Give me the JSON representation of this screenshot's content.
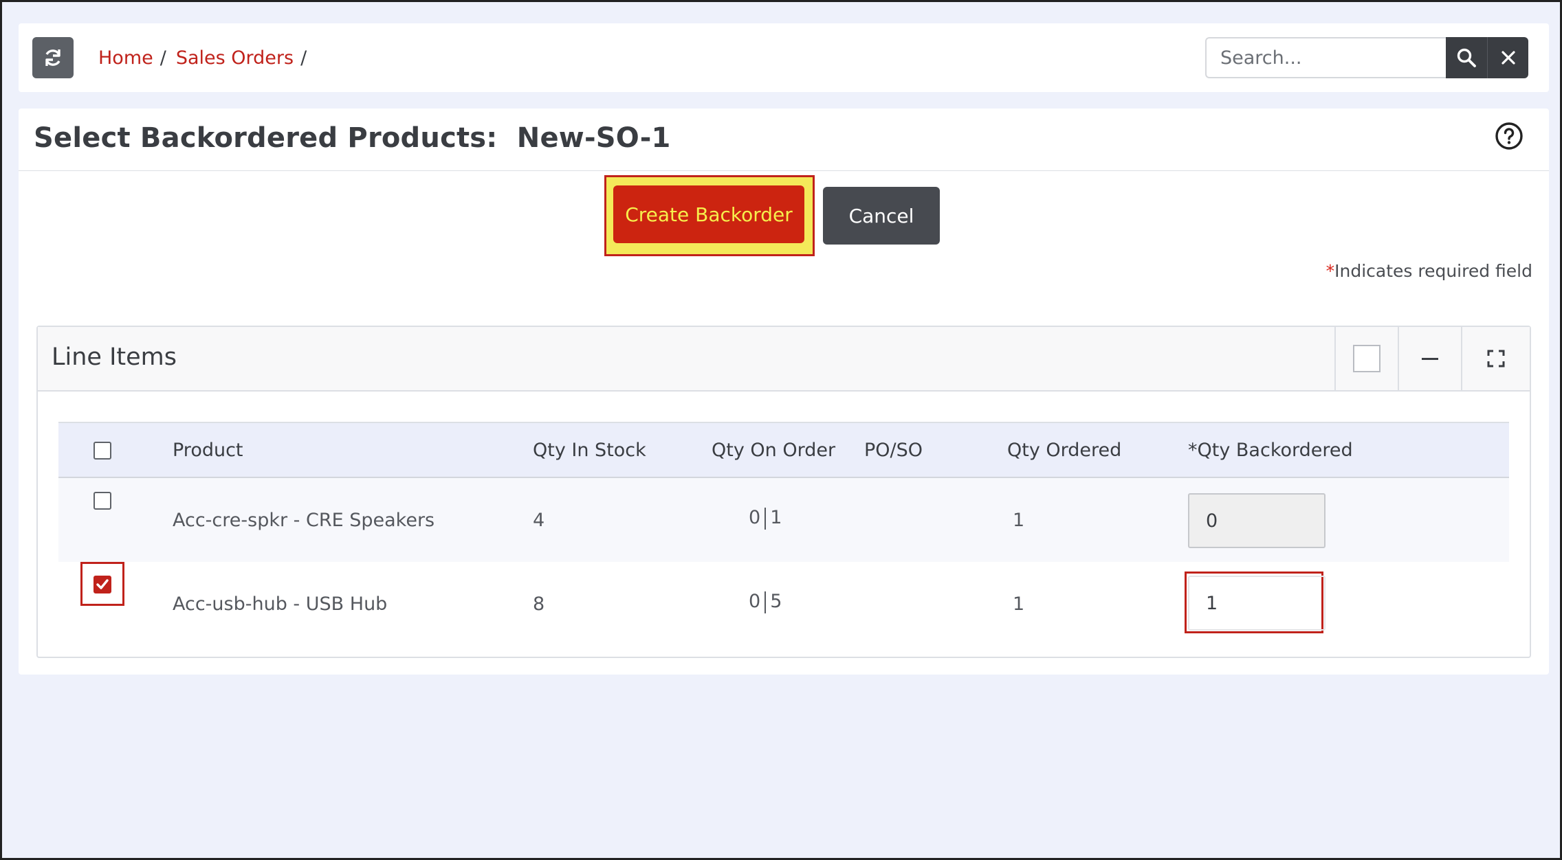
{
  "header": {
    "breadcrumb": [
      "Home",
      "Sales Orders"
    ],
    "search_placeholder": "Search...",
    "icons": [
      "refresh-icon",
      "search-icon",
      "close-icon"
    ]
  },
  "page": {
    "title_prefix": "Select Backordered Products:",
    "title_order": "New-SO-1",
    "create_label": "Create Backorder",
    "cancel_label": "Cancel",
    "required_star": "*",
    "required_text": "Indicates required field"
  },
  "panel": {
    "title": "Line Items",
    "tool_icons": [
      "select-icon",
      "minimize-icon",
      "expand-icon"
    ]
  },
  "table": {
    "columns": [
      "Product",
      "Qty In Stock",
      "Qty On Order",
      "PO/SO",
      "Qty Ordered",
      "*Qty Backordered"
    ],
    "rows": [
      {
        "checked": false,
        "product": "Acc-cre-spkr - CRE Speakers",
        "qty_in_stock": "4",
        "on_order_a": "0",
        "on_order_b": "1",
        "po_so": "",
        "qty_ordered": "1",
        "qty_backordered": "0",
        "disabled": true
      },
      {
        "checked": true,
        "product": "Acc-usb-hub - USB Hub",
        "qty_in_stock": "8",
        "on_order_a": "0",
        "on_order_b": "5",
        "po_so": "",
        "qty_ordered": "1",
        "qty_backordered": "1",
        "disabled": false
      }
    ]
  },
  "colors": {
    "brand_red": "#c0221b",
    "highlight_yellow": "#f4e95a",
    "dark_button": "#474a50",
    "page_bg": "#eef1fb"
  }
}
